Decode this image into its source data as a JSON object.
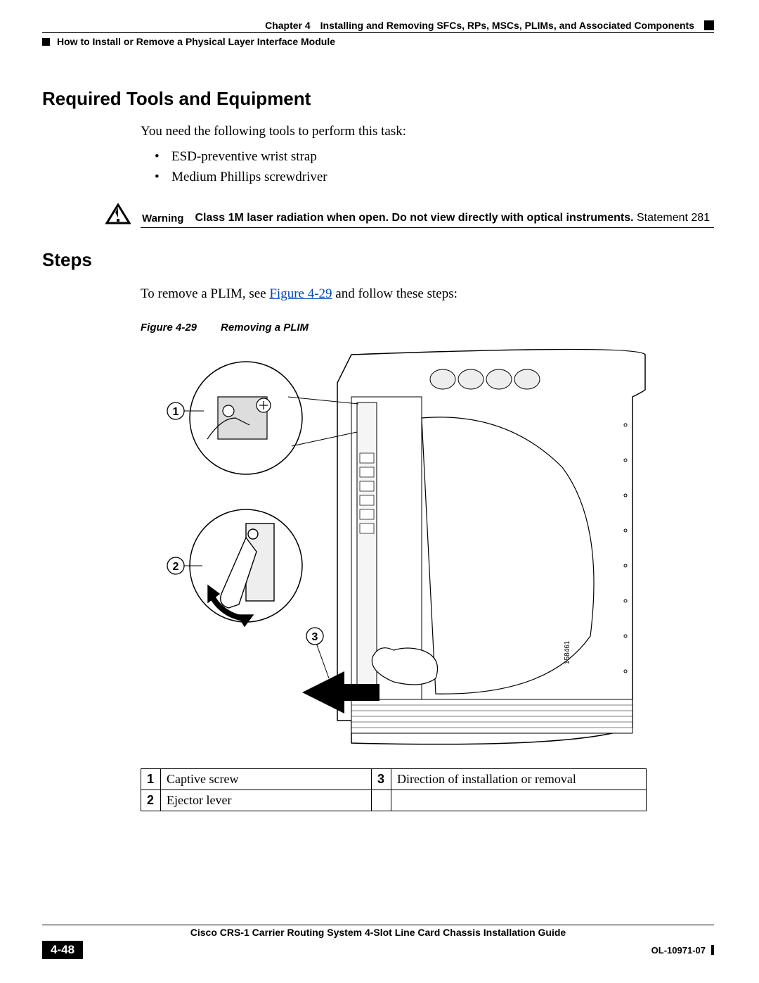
{
  "header": {
    "chapter_label": "Chapter 4",
    "chapter_title": "Installing and Removing SFCs, RPs, MSCs, PLIMs, and Associated Components",
    "section_path": "How to Install or Remove a Physical Layer Interface Module"
  },
  "sections": {
    "tools_heading": "Required Tools and Equipment",
    "tools_intro": "You need the following tools to perform this task:",
    "tools_list": [
      "ESD-preventive wrist strap",
      "Medium Phillips screwdriver"
    ],
    "warning_label": "Warning",
    "warning_bold": "Class 1M laser radiation when open. Do not view directly with optical instruments.",
    "warning_tail": " Statement 281",
    "steps_heading": "Steps",
    "steps_intro_pre": "To remove a PLIM, see ",
    "steps_intro_link": "Figure 4-29",
    "steps_intro_post": " and follow these steps:"
  },
  "figure": {
    "number": "Figure 4-29",
    "title": "Removing a PLIM",
    "art_id": "158461",
    "callouts": [
      {
        "num": "1",
        "desc": "Captive screw"
      },
      {
        "num": "2",
        "desc": "Ejector lever"
      },
      {
        "num": "3",
        "desc": "Direction of installation or removal"
      }
    ]
  },
  "footer": {
    "book_title": "Cisco CRS-1 Carrier Routing System 4-Slot Line Card Chassis Installation Guide",
    "page_number": "4-48",
    "doc_id": "OL-10971-07"
  }
}
